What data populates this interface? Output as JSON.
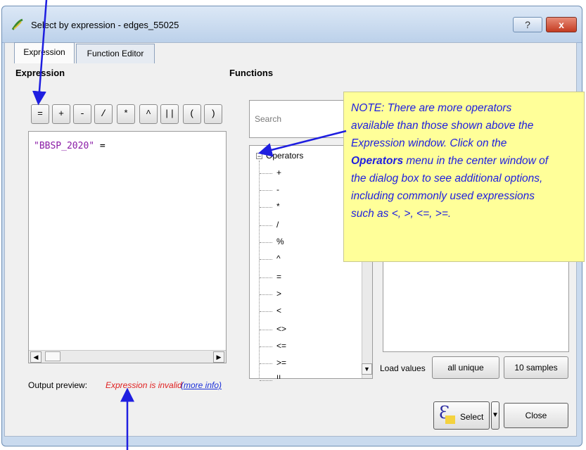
{
  "window": {
    "title": "Select by expression - edges_55025",
    "help_label": "?",
    "close_label": "x"
  },
  "tabs": [
    {
      "label": "Expression"
    },
    {
      "label": "Function Editor"
    }
  ],
  "expression_panel": {
    "heading": "Expression",
    "operators": [
      "=",
      "+",
      "-",
      "/",
      "*",
      "^",
      "||",
      "(",
      ")"
    ],
    "editor_field": "\"BBSP_2020\"",
    "editor_operator": "=",
    "output_label": "Output preview:",
    "output_error": "Expression is invalid",
    "more_info": "(more info)"
  },
  "functions_panel": {
    "heading": "Functions",
    "search_placeholder": "Search",
    "tree_root": "Operators",
    "tree_items": [
      "+",
      "-",
      "*",
      "/",
      "%",
      "^",
      "=",
      ">",
      "<",
      "<>",
      "<=",
      ">=",
      "||"
    ]
  },
  "values_panel": {
    "load_label": "Load values",
    "all_unique": "all unique",
    "samples": "10 samples"
  },
  "footer": {
    "select_label": "Select",
    "close_label": "Close"
  },
  "note": {
    "line1": "NOTE:  There are more operators",
    "line2": "available than those shown above the",
    "line3": "Expression window.  Click on the",
    "bold": "Operators",
    "line4_rest": " menu in the center window of",
    "line5": "the dialog box to see additional options,",
    "line6": "including commonly used expressions",
    "line7": "such as <, >, <=, >=."
  },
  "colors": {
    "annotation_arrow": "#1e1ee0",
    "note_bg": "#ffff99",
    "error_text": "#e02020"
  }
}
